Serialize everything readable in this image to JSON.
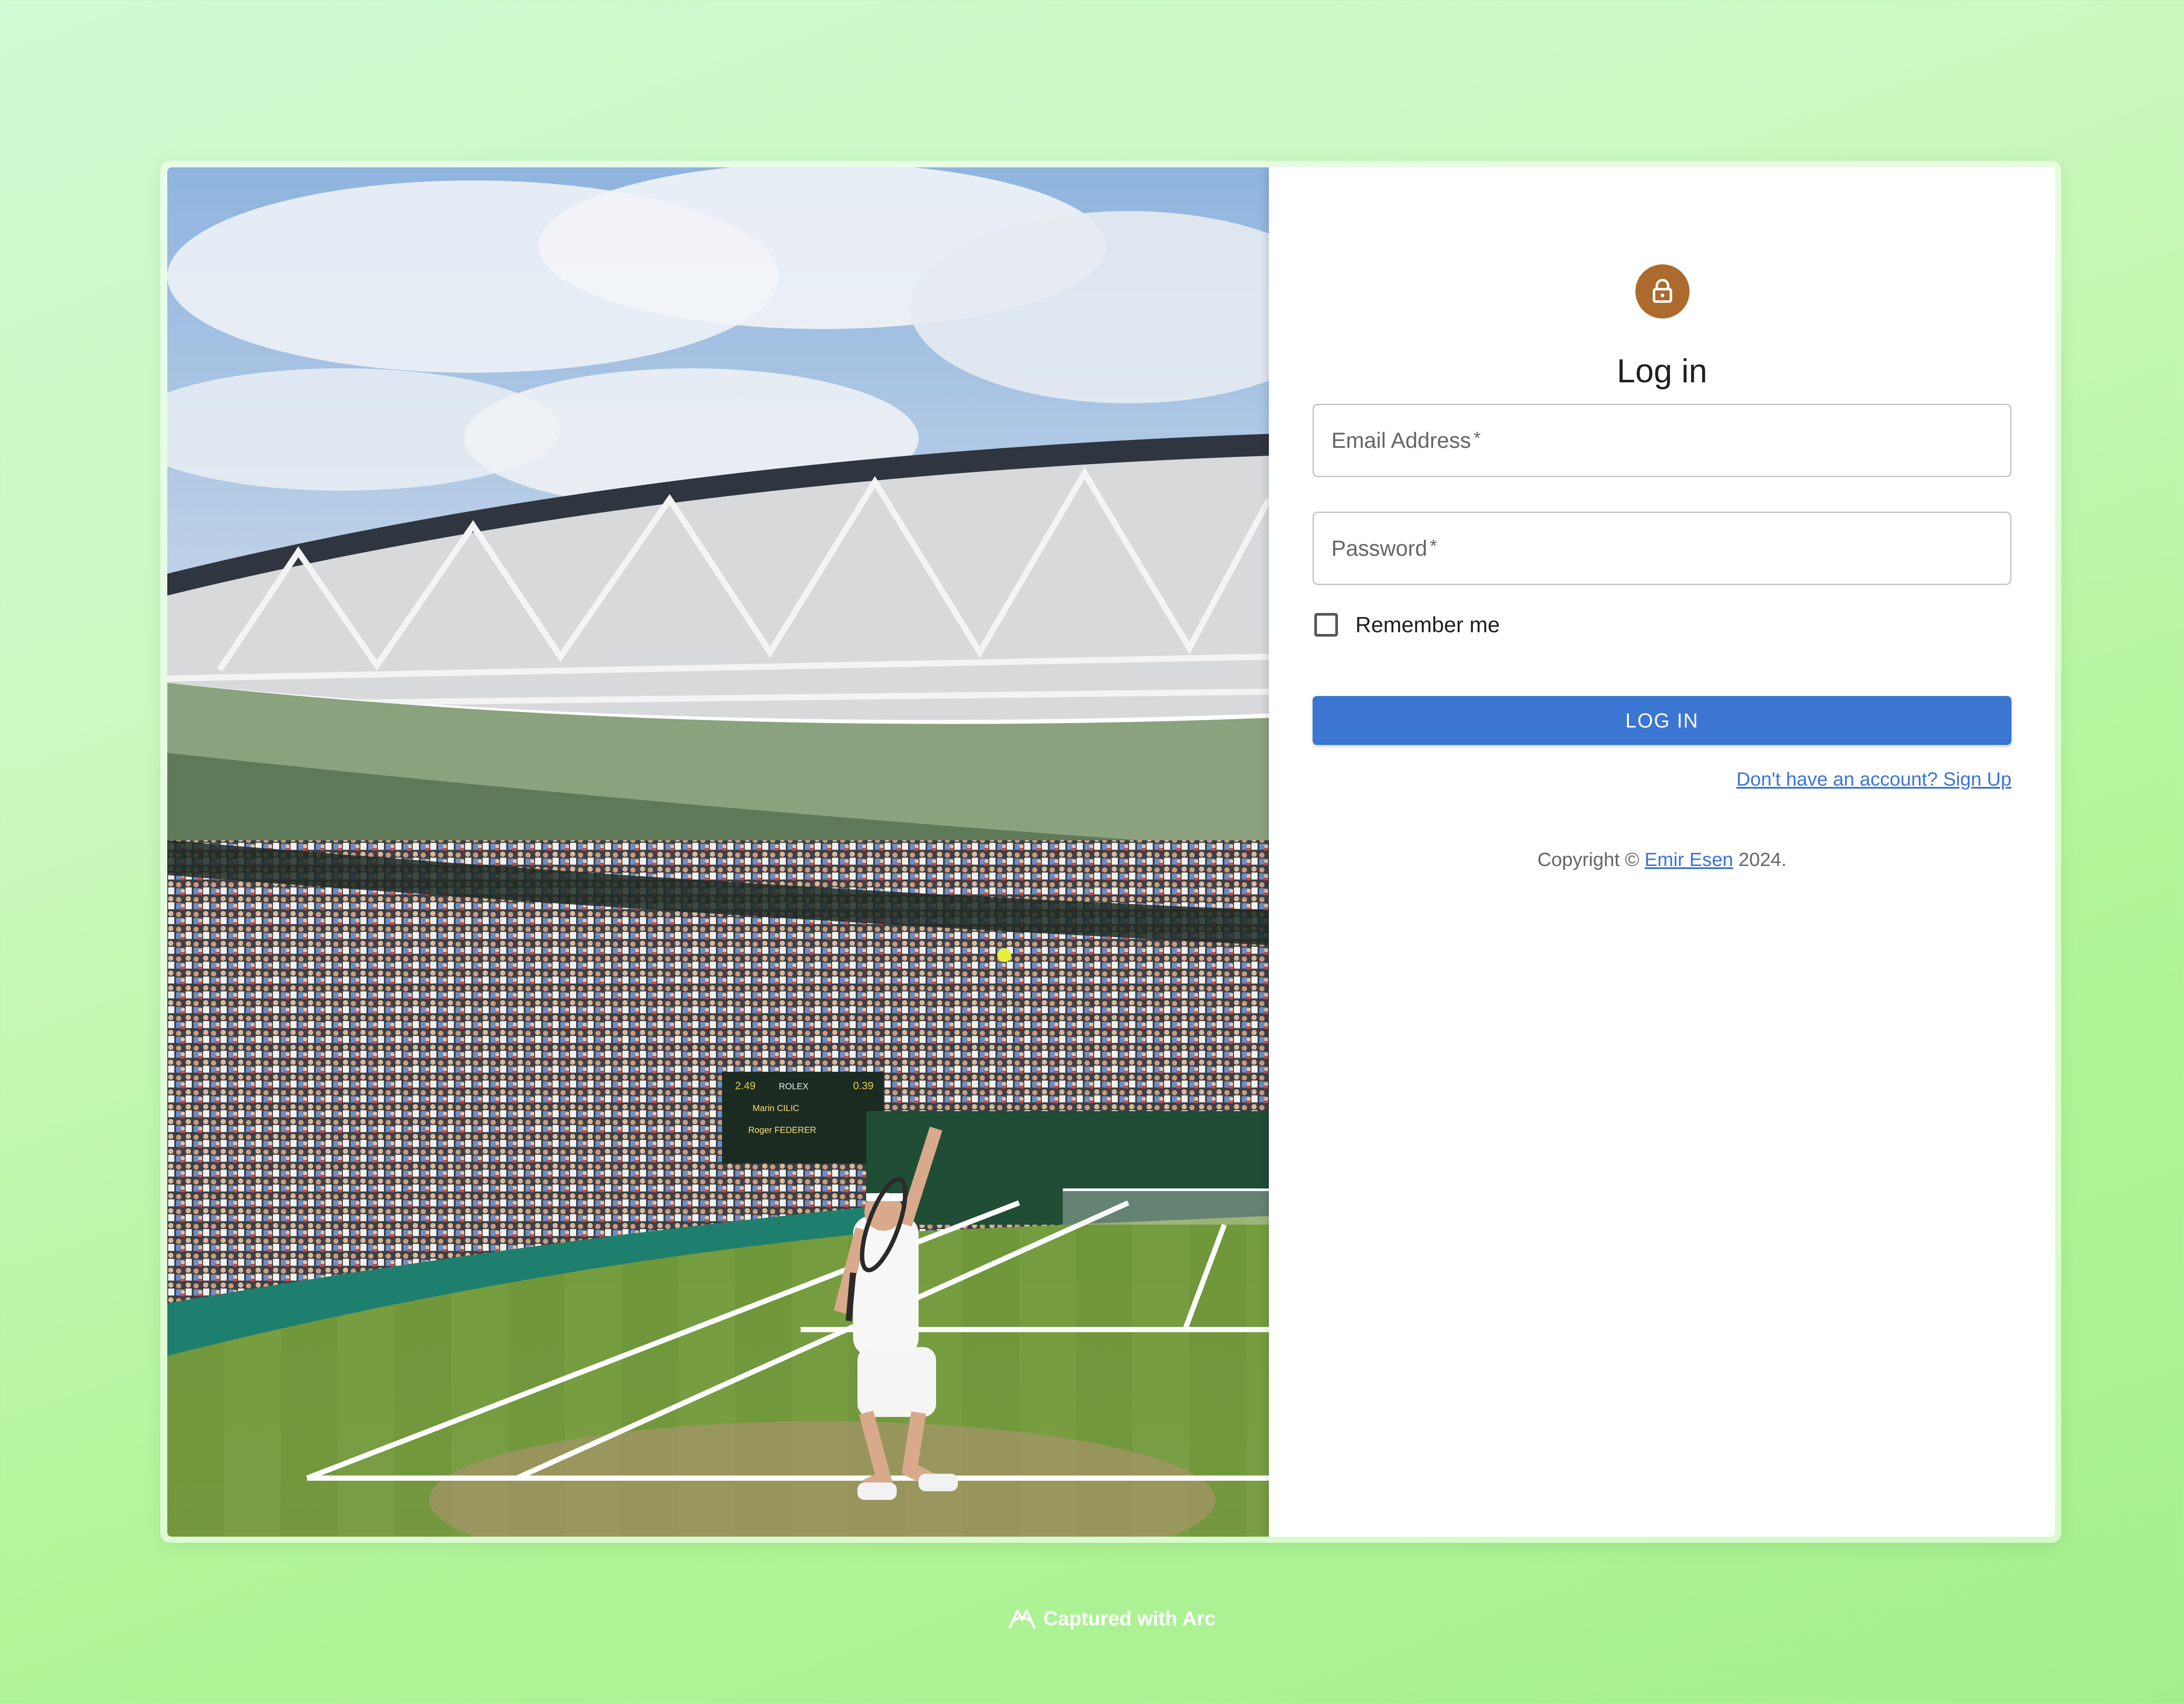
{
  "login": {
    "title": "Log in",
    "email": {
      "label": "Email Address",
      "required_mark": "*",
      "value": ""
    },
    "password": {
      "label": "Password",
      "required_mark": "*",
      "value": ""
    },
    "remember_label": "Remember me",
    "remember_checked": false,
    "submit_label": "LOG IN",
    "signup_link": "Don't have an account? Sign Up"
  },
  "footer": {
    "copyright_prefix": "Copyright ©",
    "author": "Emir Esen",
    "year_suffix": "2024."
  },
  "capture_badge": {
    "text": "Captured with Arc",
    "icon": "arc-logo-icon"
  },
  "hero_image": {
    "description_icon": "tennis-court-photo",
    "scoreboard": {
      "player_1": "Marin CILIC",
      "player_2": "Roger FEDERER",
      "brand": "ROLEX",
      "left_time": "2.49",
      "right_time": "0.39"
    }
  },
  "colors": {
    "accent": "#3a76d2",
    "avatar": "#ac6a2c",
    "background": "#b4f59a"
  }
}
